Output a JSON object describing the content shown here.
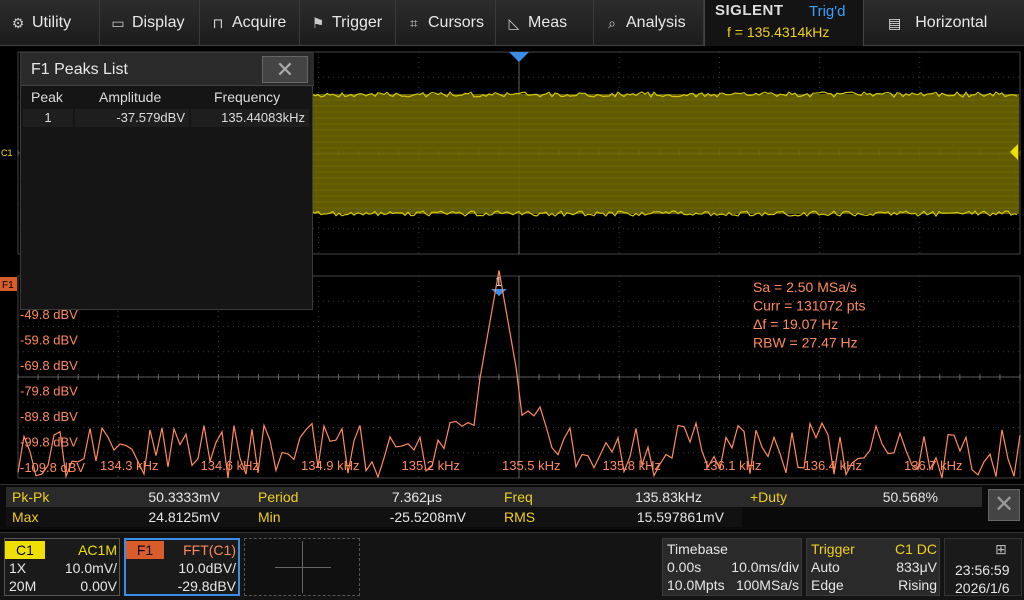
{
  "menu": {
    "items": [
      {
        "key": "utility",
        "label": "Utility",
        "icon": "gear-icon"
      },
      {
        "key": "display",
        "label": "Display",
        "icon": "monitor-icon"
      },
      {
        "key": "acquire",
        "label": "Acquire",
        "icon": "acquire-icon"
      },
      {
        "key": "trigger",
        "label": "Trigger",
        "icon": "flag-icon"
      },
      {
        "key": "cursors",
        "label": "Cursors",
        "icon": "cursor-icon"
      },
      {
        "key": "meas",
        "label": "Meas",
        "icon": "ruler-icon"
      },
      {
        "key": "analysis",
        "label": "Analysis",
        "icon": "analysis-icon"
      }
    ],
    "brand": "SIGLENT",
    "trigger_state": "Trig'd",
    "trigger_freq": "f = 135.4314kHz",
    "horizontal_label": "Horizontal"
  },
  "peaks": {
    "title": "F1 Peaks List",
    "headers": [
      "Peak",
      "Amplitude",
      "Frequency"
    ],
    "rows": [
      [
        "1",
        "-37.579dBV",
        "135.44083kHz"
      ]
    ]
  },
  "plot": {
    "c1_marker": "C1",
    "f1_marker": "F1",
    "peak_marker": "1",
    "trace_color": "#d4c800",
    "fft_color": "#ff8a5c",
    "y_labels": [
      "-49.8 dBV",
      "-59.8 dBV",
      "-69.8 dBV",
      "-79.8 dBV",
      "-89.8 dBV",
      "-99.8 dBV",
      "-109.8 dBV"
    ],
    "x_labels": [
      "134.3 kHz",
      "134.6 kHz",
      "134.9 kHz",
      "135.2 kHz",
      "135.5 kHz",
      "135.8 kHz",
      "136.1 kHz",
      "136.4 kHz",
      "136.7 kHz"
    ],
    "fft_info": [
      "Sa =  2.50 MSa/s",
      "Curr = 131072 pts",
      "Δf =  19.07 Hz",
      "RBW =  27.47 Hz"
    ],
    "peak_freq_khz": 135.44083,
    "peak_amp_dbv": -37.579
  },
  "measurements": [
    {
      "label": "Pk-Pk",
      "value": "50.3333mV"
    },
    {
      "label": "Period",
      "value": "7.362μs"
    },
    {
      "label": "Freq",
      "value": "135.83kHz"
    },
    {
      "label": "+Duty",
      "value": "50.568%"
    },
    {
      "label": "Max",
      "value": "24.8125mV"
    },
    {
      "label": "Min",
      "value": "-25.5208mV"
    },
    {
      "label": "RMS",
      "value": "15.597861mV"
    }
  ],
  "channels": {
    "c1": {
      "name": "C1",
      "coupling": "AC1M",
      "probe": "1X",
      "scale": "10.0mV/",
      "bw": "20M",
      "offset": "0.00V"
    },
    "f1": {
      "name": "F1",
      "func": "FFT(C1)",
      "scale": "10.0dBV/",
      "offset": "-29.8dBV"
    }
  },
  "timebase": {
    "title": "Timebase",
    "delay": "0.00s",
    "scale": "10.0ms/div",
    "memory": "10.0Mpts",
    "rate": "100MSa/s"
  },
  "trigger": {
    "title": "Trigger",
    "source": "C1 DC",
    "mode": "Auto",
    "level": "833μV",
    "type": "Edge",
    "slope": "Rising"
  },
  "clock": {
    "time": "23:56:59",
    "date": "2026/1/6"
  }
}
